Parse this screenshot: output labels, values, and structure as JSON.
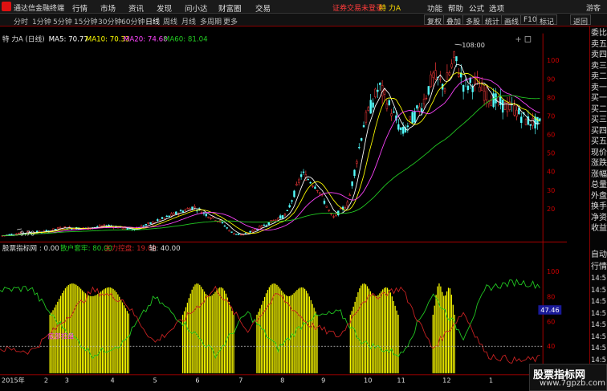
{
  "titlebar": {
    "app_name": "通达信金融终端",
    "menus": [
      "行情",
      "市场",
      "资讯",
      "发现",
      "问小达",
      "财富圈",
      "交易"
    ],
    "login_tip": "证券交易未登录",
    "stock_tab": "特 力A",
    "right_menus": [
      "功能",
      "帮助",
      "公式",
      "选项"
    ],
    "user": "游客"
  },
  "toolbar": {
    "periods": [
      "分时",
      "1分钟",
      "5分钟",
      "15分钟",
      "30分钟",
      "60分钟",
      "日线",
      "周线",
      "月线",
      "多周期",
      "更多"
    ],
    "active_period": "日线",
    "buttons": [
      "复权",
      "叠加",
      "多股",
      "统计",
      "画线",
      "F10",
      "标记",
      "返回"
    ],
    "self_select": "+自选",
    "back": "返回"
  },
  "main_legend": {
    "stock": "特 力A (日线)",
    "ma5": "MA5: 70.77",
    "ma10": "MA10: 70.33",
    "ma20": "MA20: 74.68",
    "ma60": "MA60: 81.04"
  },
  "indicator_legend": {
    "name": "股票指标网 : 0.00",
    "dianhu": "散户套牢: 80.00",
    "zhuli": "主力控盘: 19.00",
    "zhou": "轴: 40.00"
  },
  "annotations": {
    "high": "108:00",
    "low": "9.70",
    "indicator_label": "底部控盘",
    "current_value": "47.46"
  },
  "sidebar": {
    "price_items": [
      "委比",
      "卖五",
      "卖四",
      "卖三",
      "卖二",
      "卖一",
      "买一",
      "买二",
      "买三",
      "买四",
      "买五",
      "现价",
      "涨跌",
      "涨幅",
      "总量",
      "外盘",
      "换手",
      "净资",
      "收益"
    ],
    "tick_items": [
      "自动",
      "行情",
      "14:5",
      "14:5",
      "14:5",
      "14:5",
      "14:5",
      "14:5",
      "14:5",
      "14:5",
      "14:5"
    ]
  },
  "watermark": {
    "line1": "股票指标网",
    "line2": "www.7gpzb.com"
  },
  "colors": {
    "up": "#ff3b3b",
    "down": "#54ffff",
    "ma5": "#ffffff",
    "ma10": "#ffff00",
    "ma20": "#ff44ff",
    "ma60": "#22cc22",
    "indicator_bar": "#ffff00",
    "line_green": "#22cc22",
    "line_red": "#cc2222",
    "axis": "#cc0000"
  },
  "chart_data": [
    {
      "type": "candlestick",
      "title": "特 力A (日线)",
      "ylim": [
        9,
        112
      ],
      "yticks": [
        20,
        30,
        40,
        50,
        60,
        70,
        80,
        90,
        100
      ],
      "xlabels": [
        "2015年",
        "2",
        "3",
        "4",
        "5",
        "6",
        "7",
        "8",
        "9",
        "10",
        "11",
        "12",
        "1"
      ],
      "high_label": 108,
      "low_label": 9.7,
      "ma_last": {
        "MA5": 70.77,
        "MA10": 70.33,
        "MA20": 74.68,
        "MA60": 81.04
      }
    },
    {
      "type": "bar",
      "title": "股票指标网",
      "ylim": [
        10,
        105
      ],
      "yticks": [
        20,
        40,
        60,
        80,
        100
      ],
      "series": [
        {
          "name": "散户套牢",
          "value": 80
        },
        {
          "name": "主力控盘",
          "value": 19
        },
        {
          "name": "轴",
          "value": 40
        }
      ],
      "current": 47.46
    }
  ]
}
